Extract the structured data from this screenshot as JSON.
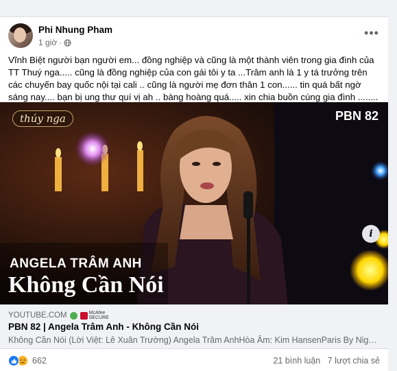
{
  "post": {
    "author": "Phi Nhung Pham",
    "time": "1 giờ",
    "privacy_icon": "globe-icon",
    "more_icon": "more-horizontal-icon",
    "text": "Vĩnh Biệt người bạn người em... đồng nghiệp và cũng là một thành viên trong gia đình của TT Thuý nga..... cũng là đồng nghiệp của con gái tôi y ta ...Trâm anh là 1 y tá trưởng trên các chuyến bay quốc nội tại cali .. cũng là người mẹ đơn thân 1 con...... tin quá bất ngờ sáng nay.... bạn bị ung thư quí vị ah .. bàng hoàng quá..... xin chia buồn cùng gia đình ........"
  },
  "media": {
    "logo_text": "thúy nga",
    "episode_badge": "PBN 82",
    "singer_overlay": "ANGELA TRÂM ANH",
    "song_overlay": "Không Cần Nói"
  },
  "link_preview": {
    "domain": "YOUTUBE.COM",
    "mcafee_label_1": "McAfee",
    "mcafee_label_2": "SECURE",
    "title": "PBN 82 | Angela Trâm Anh - Không Cần Nói",
    "description": "Không Cần Nói (Lời Việt: Lê Xuân Trường) Angela Trâm AnhHòa Âm: Kim HansenParis By Night..."
  },
  "stats": {
    "reaction_count": "662",
    "comments": "21 bình luận",
    "shares": "7 lượt chia sẻ"
  },
  "colors": {
    "facebook_blue": "#1877f2",
    "text_secondary": "#65676b",
    "card_bg": "#ffffff",
    "page_bg": "#f0f2f5"
  }
}
